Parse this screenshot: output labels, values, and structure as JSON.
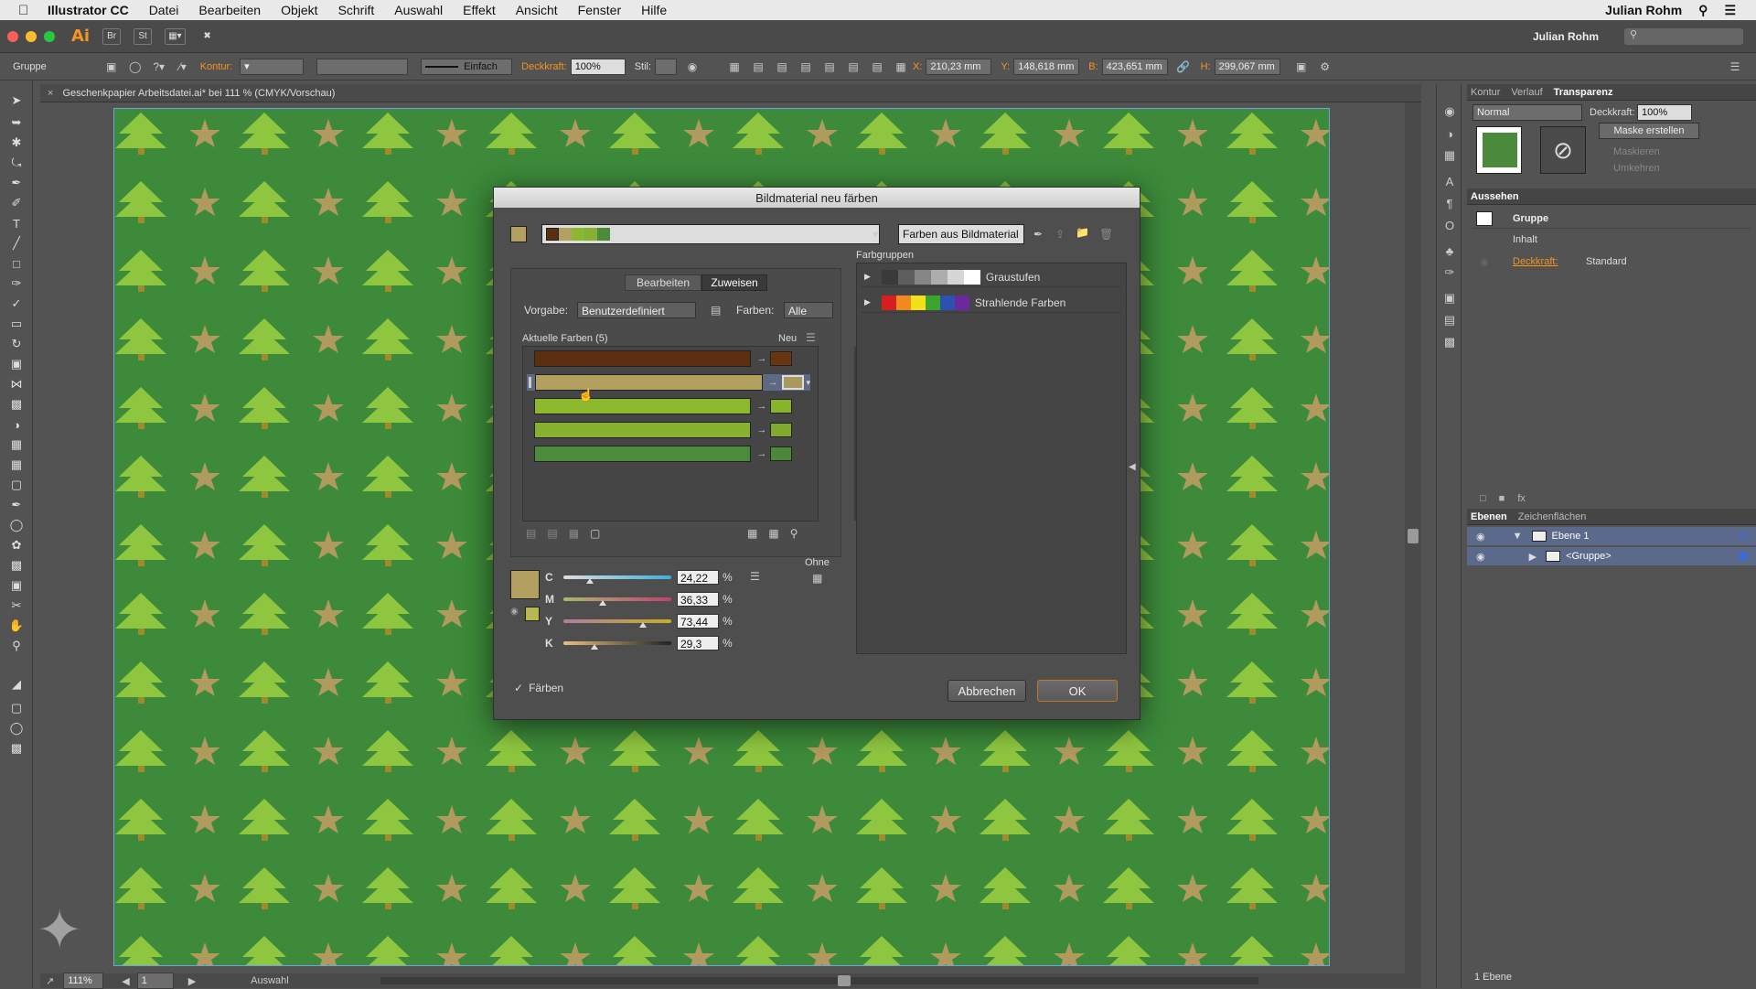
{
  "menubar": {
    "app_name": "Illustrator CC",
    "items": [
      "Datei",
      "Bearbeiten",
      "Objekt",
      "Schrift",
      "Auswahl",
      "Effekt",
      "Ansicht",
      "Fenster",
      "Hilfe"
    ],
    "user": "Julian Rohm"
  },
  "appbar": {
    "logo": "Ai",
    "bridge": "Br",
    "stock": "St",
    "workspace_user": "Julian Rohm"
  },
  "control": {
    "selection": "Gruppe",
    "kontur_label": "Kontur:",
    "stroke_profile": "Einfach",
    "deckkraft_label": "Deckkraft:",
    "deckkraft_value": "100%",
    "stil_label": "Stil:",
    "x_label": "X:",
    "x_value": "210,23 mm",
    "y_label": "Y:",
    "y_value": "148,618 mm",
    "b_label": "B:",
    "b_value": "423,651 mm",
    "h_label": "H:",
    "h_value": "299,067 mm"
  },
  "document": {
    "tab_title": "Geschenkpapier Arbeitsdatei.ai* bei 111 % (CMYK/Vorschau)",
    "zoom": "111%",
    "artboard_num": "1",
    "status": "Auswahl"
  },
  "dialog": {
    "title": "Bildmaterial neu färben",
    "colors_from_art": "Farben aus Bildmaterial",
    "tab_edit": "Bearbeiten",
    "tab_assign": "Zuweisen",
    "preset_label": "Vorgabe:",
    "preset_value": "Benutzerdefiniert",
    "colors_label": "Farben:",
    "colors_value": "Alle",
    "current_colors_label": "Aktuelle Farben (5)",
    "new_label": "Neu",
    "current_colors": [
      {
        "current": "#5a2e0e",
        "new": "#6a3510"
      },
      {
        "current": "#b3a060",
        "new": "#a89a5c"
      },
      {
        "current": "#8cb82e",
        "new": "#88b42c"
      },
      {
        "current": "#86b030",
        "new": "#80aa2c"
      },
      {
        "current": "#4c8a3c",
        "new": "#4a883a"
      }
    ],
    "ohne_label": "Ohne",
    "cmyk": [
      {
        "label": "C",
        "value": "24,22",
        "fraction": 0.2422
      },
      {
        "label": "M",
        "value": "36,33",
        "fraction": 0.3633
      },
      {
        "label": "Y",
        "value": "73,44",
        "fraction": 0.7344
      },
      {
        "label": "K",
        "value": "29,3",
        "fraction": 0.293
      }
    ],
    "percent": "%",
    "recolor_checkbox": "Färben",
    "cancel": "Abbrechen",
    "ok": "OK",
    "color_groups_label": "Farbgruppen",
    "color_groups": [
      {
        "name": "Graustufen",
        "colors": [
          "#3a3a3a",
          "#5e5e5e",
          "#858585",
          "#adadad",
          "#d6d6d6",
          "#ffffff"
        ]
      },
      {
        "name": "Strahlende Farben",
        "colors": [
          "#d62020",
          "#f08a1c",
          "#f2e01a",
          "#3aa62c",
          "#2a52b0",
          "#6a2a9c"
        ]
      }
    ],
    "selected_swatch": "#b3a060",
    "selected_swatch_alt": "#b8b850"
  },
  "panels": {
    "top_tabs": [
      "Kontur",
      "Verlauf",
      "Transparenz"
    ],
    "blend_mode": "Normal",
    "opacity_label": "Deckkraft:",
    "opacity_value": "100%",
    "make_mask": "Maske erstellen",
    "mask_clip": "Maskieren",
    "mask_invert": "Umkehren",
    "appearance_tab": "Aussehen",
    "appearance_object": "Gruppe",
    "appearance_content": "Inhalt",
    "appearance_opacity_label": "Deckkraft:",
    "appearance_opacity_value": "Standard",
    "layers_tabs": [
      "Ebenen",
      "Zeichenflächen"
    ],
    "layer_name": "Ebene 1",
    "sublayer_name": "<Gruppe>",
    "layers_count": "1 Ebene"
  },
  "colors": {
    "artboard_bg": "#3c8a3a",
    "tree": "#8ec63f",
    "trunk": "#a08a2a",
    "star": "#b09a5e",
    "accent": "#f7931e"
  }
}
